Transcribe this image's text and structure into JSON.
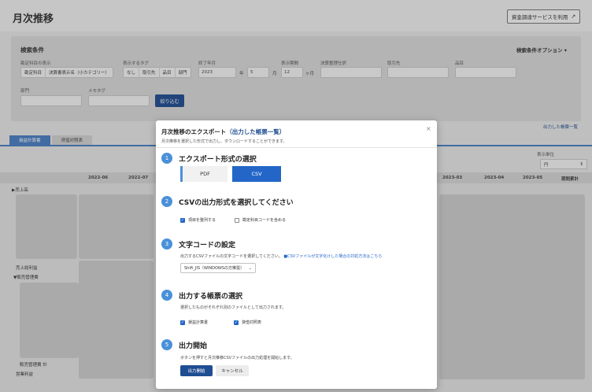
{
  "header": {
    "title": "月次推移",
    "fund_button": "資金調達サービスを利用",
    "fund_button_icon": "external-link-icon"
  },
  "search": {
    "title": "検索条件",
    "options_label": "検索条件オプション",
    "account_display_label": "勘定科目の表示",
    "account_display_options": [
      "勘定科目",
      "決算書表示名（小カテゴリー）"
    ],
    "tags_label": "表示するタグ",
    "tags_options": [
      "なし",
      "取引先",
      "品目",
      "部門"
    ],
    "end_month_label": "終了年月",
    "end_year": "2023",
    "end_year_unit": "年",
    "end_month": "5",
    "end_month_unit": "月",
    "period_label": "表示期間",
    "period_value": "12",
    "period_unit": "ヶ月",
    "settlement_label": "決算整理仕訳",
    "partner_label": "取引先",
    "item_label": "品目",
    "department_label": "部門",
    "memo_label": "メモタグ",
    "filter_button": "絞り込む"
  },
  "tabs": [
    "損益計算書",
    "貸借対照表"
  ],
  "output_list_link": "出力した帳票一覧",
  "display_unit_label": "表示単位",
  "display_unit_value": "円",
  "table": {
    "columns": [
      "2022-06",
      "2022-07",
      "2023-03",
      "2023-04",
      "2023-05",
      "期間累計"
    ],
    "rows": [
      "▶売上高",
      "売上総利益",
      "▼販売管理費",
      "販売管理費 計",
      "営業利益"
    ]
  },
  "modal": {
    "title": "月次推移のエクスポート",
    "title_link": "（出力した帳票一覧）",
    "subtitle": "月次推移を選択した形式で出力し、ダウンロードすることができます。",
    "steps": [
      {
        "num": "1",
        "title": "エクスポート形式の選択"
      },
      {
        "num": "2",
        "title": "CSVの出力形式を選択してください"
      },
      {
        "num": "3",
        "title": "文字コードの設定",
        "desc": "出力するCSVファイルの文字コードを選択してください。",
        "link": "■CSVファイルが文字化けした場合の対処方法はこちら"
      },
      {
        "num": "4",
        "title": "出力する帳票の選択",
        "desc": "選択したものがそれぞれ別のファイルとして出力されます。"
      },
      {
        "num": "5",
        "title": "出力開始",
        "desc": "ボタンを押すと月次推移CSVファイルの出力処理を開始します。"
      }
    ],
    "format_pdf": "PDF",
    "format_csv": "CSV",
    "csv_options": [
      {
        "label": "項目を整列する",
        "checked": true
      },
      {
        "label": "勘定科目コードを含める",
        "checked": false
      }
    ],
    "encoding_value": "Shift_JIS（WINDOWSの方推奨）",
    "reports": [
      {
        "label": "損益計算書",
        "checked": true
      },
      {
        "label": "貸借対照表",
        "checked": true
      }
    ],
    "start_button": "出力開始",
    "cancel_button": "キャンセル",
    "close_icon": "close-icon"
  }
}
